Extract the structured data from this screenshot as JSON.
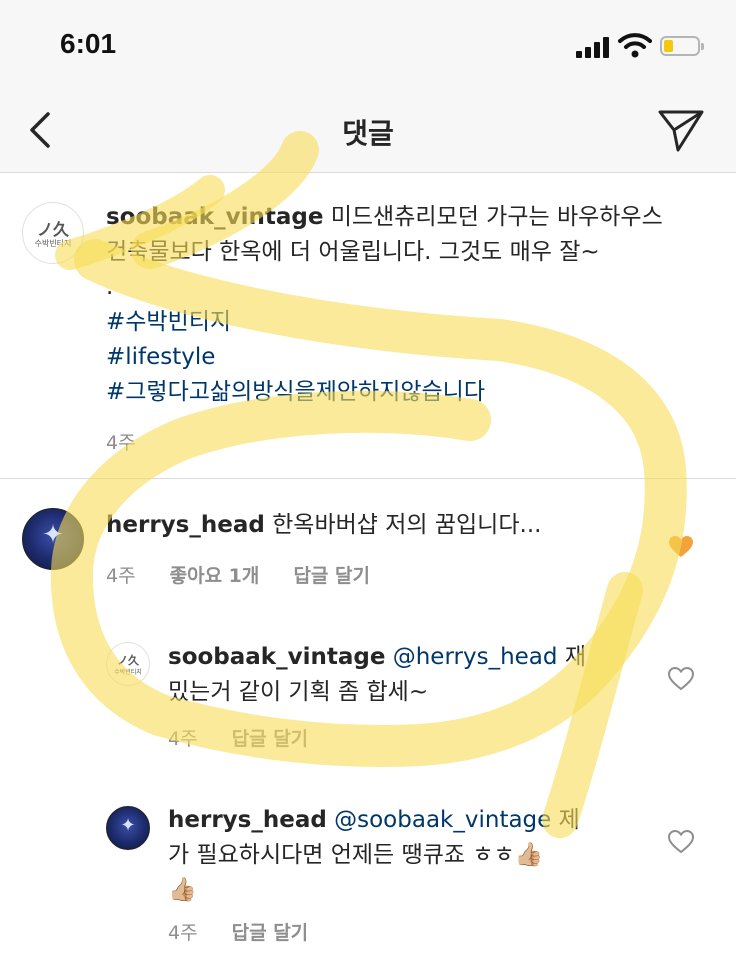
{
  "status_bar": {
    "time": "6:01"
  },
  "header": {
    "title": "댓글"
  },
  "caption": {
    "username": "soobaak_vintage",
    "text_line1": "미드샌츄리모던 가구는 바우하우스",
    "text_line2": "건축물보다 한옥에 더 어울립니다. 그것도 매우 잘~",
    "dot": ".",
    "hashtags": [
      "#수박빈티지",
      "#lifestyle",
      "#그렇다고삶의방식을제안하지않습니다"
    ],
    "time": "4주",
    "avatar_mark": "ノ久",
    "avatar_caption": "수박빈티지"
  },
  "comments": [
    {
      "username": "herrys_head",
      "text": "한옥바버샵 저의 꿈입니다...",
      "time": "4주",
      "likes": "좋아요 1개",
      "reply": "답글 달기",
      "liked": true
    }
  ],
  "replies": [
    {
      "username": "soobaak_vintage",
      "mention": "@herrys_head",
      "text_line1_tail": "재",
      "text_line2": "밌는거 같이 기획 좀 합세~",
      "time": "4주",
      "reply": "답글 달기"
    },
    {
      "username": "herrys_head",
      "mention": "@soobaak_vintage",
      "text_line1_tail": "제",
      "text_line2": "가 필요하시다면 언제든 땡큐죠 ㅎㅎ👍🏼",
      "text_line3": "👍🏼",
      "time": "4주",
      "reply": "답글 달기"
    }
  ],
  "colors": {
    "link": "#00376b",
    "meta": "#8e8e8e",
    "heart_liked": "#f2a33a",
    "highlight": "#f7dc55"
  }
}
